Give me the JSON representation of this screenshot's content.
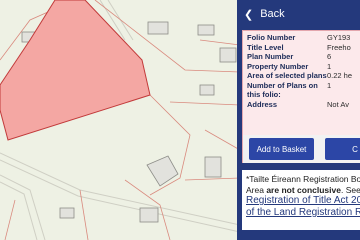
{
  "panel": {
    "back_label": "Back",
    "back_icon": "chevron-left-icon",
    "accent_color": "#24397c",
    "folio": [
      {
        "label": "Folio Number",
        "value": "GY193"
      },
      {
        "label": "Title Level",
        "value": "Freeho"
      },
      {
        "label": "Plan Number",
        "value": "6"
      },
      {
        "label": "Property Number",
        "value": "1"
      },
      {
        "label": "Area of selected plans",
        "value": "0.22 he"
      },
      {
        "label": "Number of Plans on this folio:",
        "value": "1"
      },
      {
        "label": "Address",
        "value": "Not Av"
      }
    ],
    "add_to_basket": "Add to Basket",
    "second_button": "C",
    "notice_line1": "*Tailte Éireann Registration Bo",
    "notice_line2_pre": "Area ",
    "notice_line2_bold": "are not conclusive",
    "notice_line2_post": ". See ",
    "link_line1": "Registration of Title Act 20",
    "link_line2": "of the Land Registration Ru"
  },
  "map": {
    "plot_fill": "#f4a7a3",
    "plot_stroke": "#c23a3a"
  }
}
